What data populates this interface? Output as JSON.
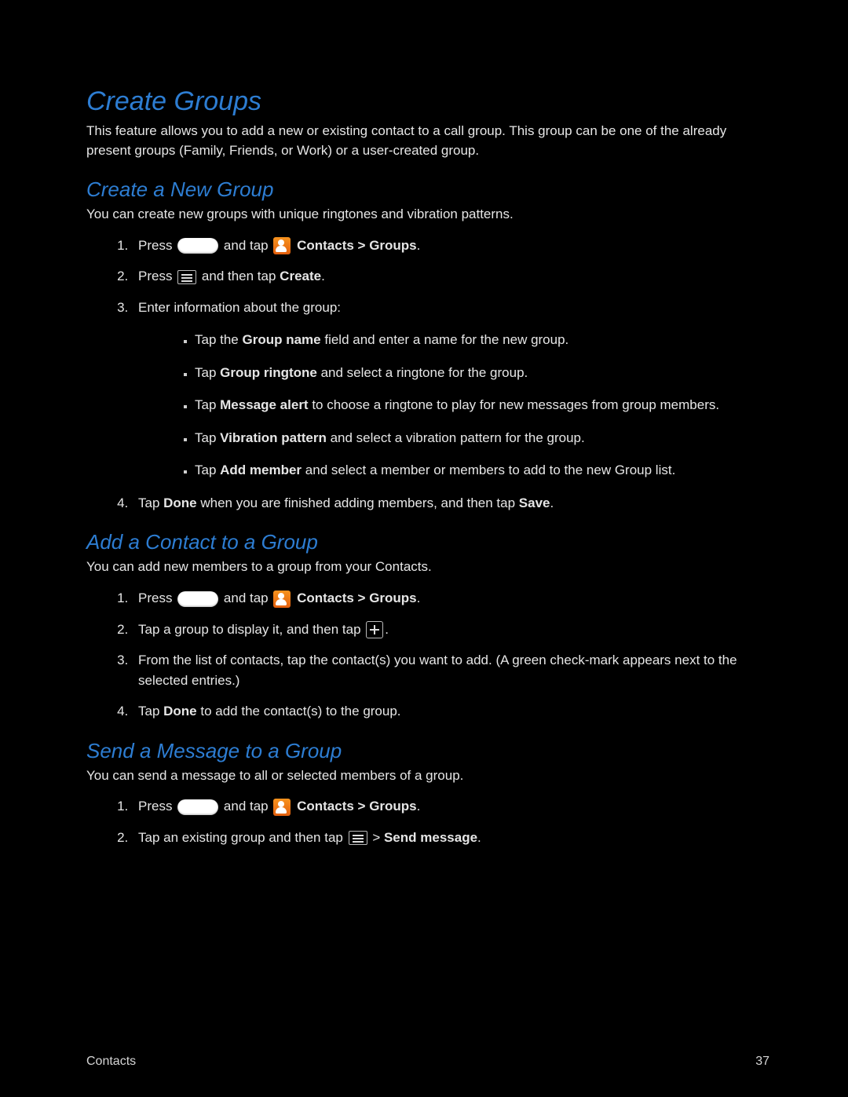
{
  "h1": "Create Groups",
  "intro": "This feature allows you to add a new or existing contact to a call group. This group can be one of the already present groups (Family, Friends, or Work) or a user-created group.",
  "sec1": {
    "title": "Create a New Group",
    "lead": "You can create new groups with unique ringtones and vibration patterns.",
    "li1a": "Press ",
    "li1b": " and tap ",
    "li1c": " Contacts > Groups",
    "li1d": ".",
    "li2a": "Press ",
    "li2b": " and then tap ",
    "li2c": "Create",
    "li2d": ".",
    "li3": "Enter information about the group:",
    "b1a": "Tap the ",
    "b1b": "Group name",
    "b1c": " field and enter a name for the new group.",
    "b2a": "Tap ",
    "b2b": "Group ringtone",
    "b2c": " and select a ringtone for the group.",
    "b3a": "Tap ",
    "b3b": "Message alert",
    "b3c": " to choose a ringtone to play for new messages from group members.",
    "b4a": "Tap ",
    "b4b": "Vibration pattern",
    "b4c": " and select a vibration pattern for the group.",
    "b5a": "Tap ",
    "b5b": "Add member",
    "b5c": " and select a member or members to add to the new Group list.",
    "li4a": "Tap ",
    "li4b": "Done",
    "li4c": " when you are finished adding members, and then tap ",
    "li4d": "Save",
    "li4e": "."
  },
  "sec2": {
    "title": "Add a Contact to a Group",
    "lead": "You can add new members to a group from your Contacts.",
    "li1a": "Press ",
    "li1b": " and tap ",
    "li1c": " Contacts > Groups",
    "li1d": ".",
    "li2a": "Tap a group to display it, and then tap ",
    "li2b": ".",
    "li3": "From the list of contacts, tap the contact(s) you want to add. (A green check-mark appears next to the selected entries.)",
    "li4a": "Tap ",
    "li4b": "Done",
    "li4c": " to add the contact(s) to the group."
  },
  "sec3": {
    "title": "Send a Message to a Group",
    "lead": "You can send a message to all or selected members of a group.",
    "li1a": "Press ",
    "li1b": " and tap ",
    "li1c": " Contacts > Groups",
    "li1d": ".",
    "li2a": "Tap an existing group and then tap ",
    "li2b": " > ",
    "li2c": "Send message",
    "li2d": "."
  },
  "footer": {
    "left": "Contacts",
    "right": "37"
  }
}
